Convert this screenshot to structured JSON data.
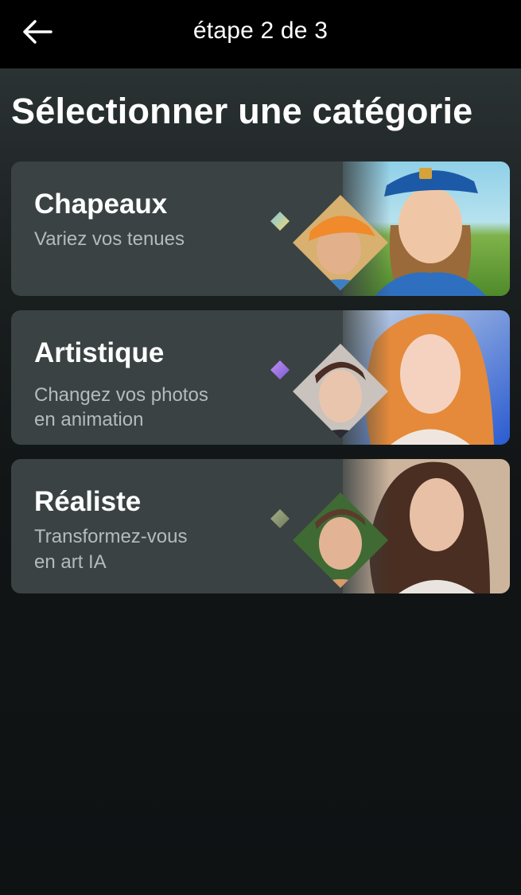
{
  "header": {
    "back_icon": "arrow-left-icon",
    "step_label": "étape 2 de 3"
  },
  "page": {
    "title": "Sélectionner une catégorie"
  },
  "categories": [
    {
      "title": "Chapeaux",
      "subtitle_lines": [
        "Variez vos tenues"
      ],
      "sparkle_colors": [
        "#7fc6e3",
        "#f3d86e"
      ],
      "thumb_accent": "#f08a2a"
    },
    {
      "title": "Artistique",
      "subtitle_lines": [
        "Changez vos photos",
        "en animation"
      ],
      "sparkle_colors": [
        "#c28ff0",
        "#7a5bd6"
      ],
      "thumb_accent": "#c88458"
    },
    {
      "title": "Réaliste",
      "subtitle_lines": [
        "Transformez-vous",
        "en art IA"
      ],
      "sparkle_colors": [
        "#a7b28a",
        "#6e7a5a"
      ],
      "thumb_accent": "#5c3b2c"
    }
  ]
}
